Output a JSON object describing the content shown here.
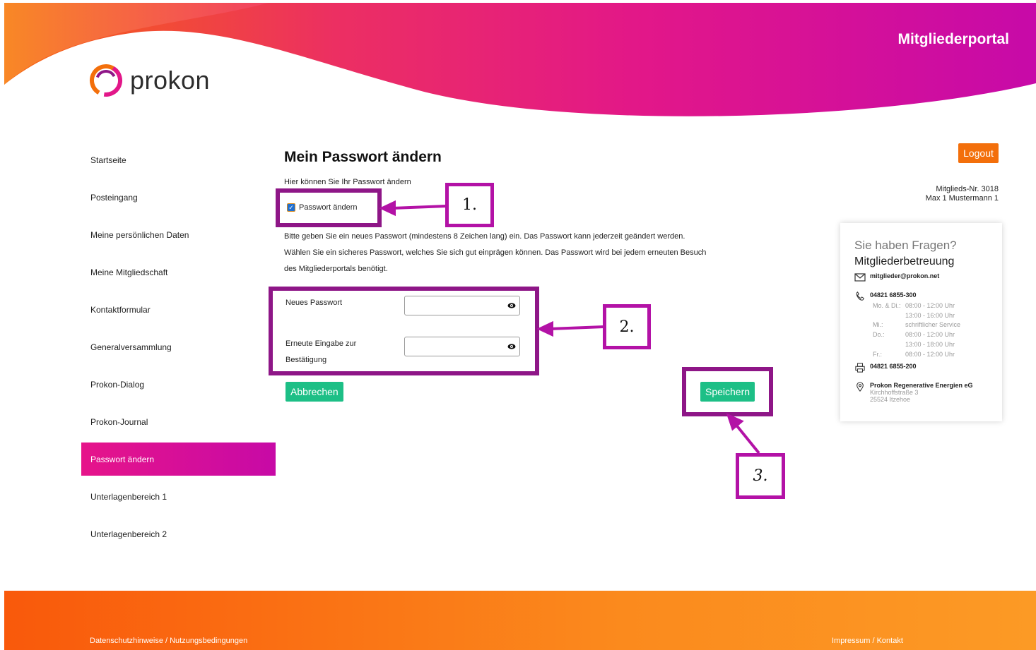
{
  "header": {
    "portal_title": "Mitgliederportal",
    "logo_text": "prokon"
  },
  "sidebar": {
    "items": [
      {
        "label": "Startseite",
        "active": false
      },
      {
        "label": "Posteingang",
        "active": false
      },
      {
        "label": "Meine persönlichen Daten",
        "active": false
      },
      {
        "label": "Meine Mitgliedschaft",
        "active": false
      },
      {
        "label": "Kontaktformular",
        "active": false
      },
      {
        "label": "Generalversammlung",
        "active": false
      },
      {
        "label": "Prokon-Dialog",
        "active": false
      },
      {
        "label": "Prokon-Journal",
        "active": false
      },
      {
        "label": "Passwort ändern",
        "active": true
      },
      {
        "label": "Unterlagenbereich 1",
        "active": false
      },
      {
        "label": "Unterlagenbereich 2",
        "active": false
      }
    ]
  },
  "main": {
    "title": "Mein Passwort ändern",
    "intro": "Hier können Sie Ihr Passwort ändern",
    "checkbox_label": "Passwort ändern",
    "checkbox_checked": true,
    "description_lines": [
      "Bitte geben Sie ein neues Passwort (mindestens 8 Zeichen lang) ein. Das Passwort kann jederzeit geändert werden.",
      "Wählen Sie ein sicheres Passwort, welches Sie sich gut einprägen können. Das Passwort wird bei jedem erneuten Besuch",
      "des Mitgliederportals benötigt."
    ],
    "new_password_label": "Neues Passwort",
    "confirm_password_label": "Erneute Eingabe zur Bestätigung",
    "new_password_value": "",
    "confirm_password_value": "",
    "cancel_label": "Abbrechen",
    "save_label": "Speichern"
  },
  "annotations": {
    "step1": "1.",
    "step2": "2.",
    "step3": "3.",
    "color": "#8e1687"
  },
  "account": {
    "logout_label": "Logout",
    "member_number": "Mitglieds-Nr. 3018",
    "member_name": "Max 1 Mustermann 1"
  },
  "contact_card": {
    "question": "Sie haben Fragen?",
    "heading": "Mitgliederbetreuung",
    "email": "mitglieder@prokon.net",
    "phone": "04821 6855-300",
    "hours": [
      {
        "day": "Mo. & Di.:",
        "time": "08:00 - 12:00 Uhr"
      },
      {
        "day": "",
        "time": "13:00 - 16:00 Uhr"
      },
      {
        "day": "Mi.:",
        "time": "schriftlicher Service"
      },
      {
        "day": "Do.:",
        "time": "08:00 - 12:00 Uhr"
      },
      {
        "day": "",
        "time": "13:00 - 18:00 Uhr"
      },
      {
        "day": "Fr.:",
        "time": "08:00 - 12:00 Uhr"
      }
    ],
    "fax": "04821 6855-200",
    "company": "Prokon Regenerative Energien eG",
    "street": "Kirchhoffstraße 3",
    "city": "25524 Itzehoe"
  },
  "footer": {
    "privacy_link": "Datenschutzhinweise / Nutzungsbedingungen",
    "imprint_link": "Impressum / Kontakt"
  },
  "colors": {
    "accent_magenta": "#c70aa6",
    "accent_orange": "#f36f0b",
    "button_green": "#1dbf86"
  }
}
